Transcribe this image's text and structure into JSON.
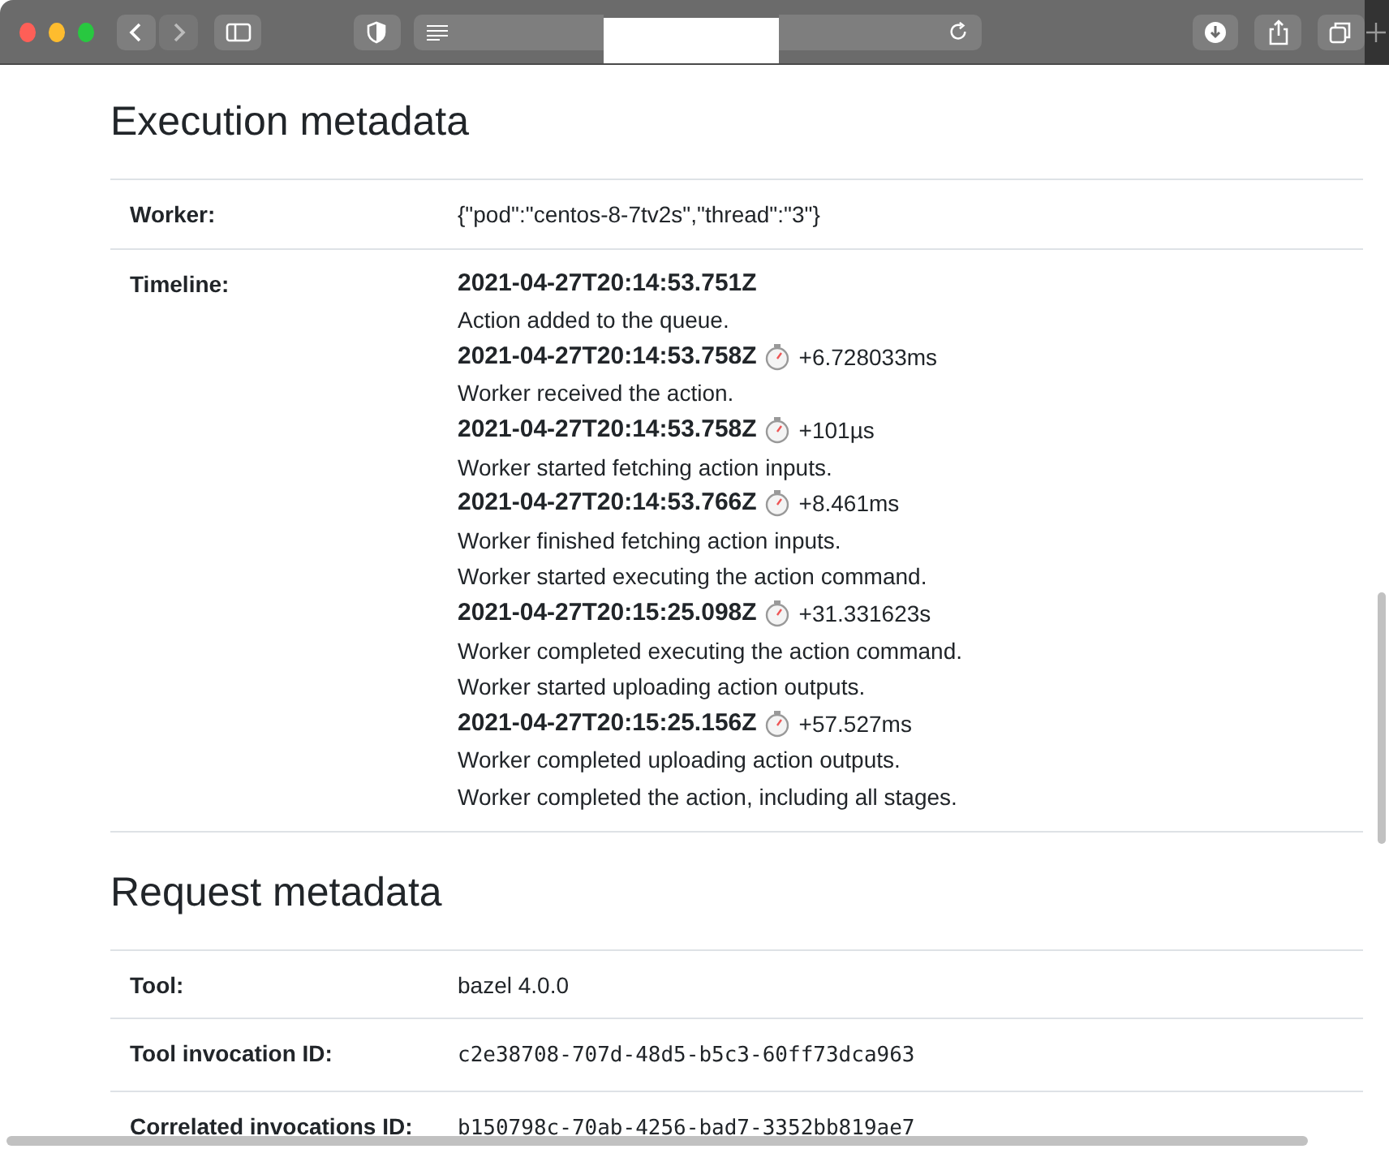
{
  "sections": [
    {
      "title": "Execution metadata",
      "rows": [
        {
          "label": "Worker:",
          "kind": "text",
          "value": "{\"pod\":\"centos-8-7tv2s\",\"thread\":\"3\"}"
        },
        {
          "label": "Timeline:",
          "kind": "timeline",
          "lines": [
            {
              "kind": "timestamp",
              "time": "2021-04-27T20:14:53.751Z"
            },
            {
              "kind": "message",
              "text": "Action added to the queue."
            },
            {
              "kind": "timestamp",
              "time": "2021-04-27T20:14:53.758Z",
              "delta": "+6.728033ms"
            },
            {
              "kind": "message",
              "text": "Worker received the action."
            },
            {
              "kind": "timestamp",
              "time": "2021-04-27T20:14:53.758Z",
              "delta": "+101µs"
            },
            {
              "kind": "message",
              "text": "Worker started fetching action inputs."
            },
            {
              "kind": "timestamp",
              "time": "2021-04-27T20:14:53.766Z",
              "delta": "+8.461ms"
            },
            {
              "kind": "message",
              "text": "Worker finished fetching action inputs."
            },
            {
              "kind": "message",
              "text": "Worker started executing the action command."
            },
            {
              "kind": "timestamp",
              "time": "2021-04-27T20:15:25.098Z",
              "delta": "+31.331623s"
            },
            {
              "kind": "message",
              "text": "Worker completed executing the action command."
            },
            {
              "kind": "message",
              "text": "Worker started uploading action outputs."
            },
            {
              "kind": "timestamp",
              "time": "2021-04-27T20:15:25.156Z",
              "delta": "+57.527ms"
            },
            {
              "kind": "message",
              "text": "Worker completed uploading action outputs."
            },
            {
              "kind": "message",
              "text": "Worker completed the action, including all stages."
            }
          ]
        }
      ]
    },
    {
      "title": "Request metadata",
      "rows": [
        {
          "label": "Tool:",
          "kind": "text",
          "value": "bazel 4.0.0"
        },
        {
          "label": "Tool invocation ID:",
          "kind": "code",
          "value": "c2e38708-707d-48d5-b5c3-60ff73dca963"
        },
        {
          "label": "Correlated invocations ID:",
          "kind": "code",
          "value": "b150798c-70ab-4256-bad7-3352bb819ae7"
        }
      ]
    }
  ]
}
